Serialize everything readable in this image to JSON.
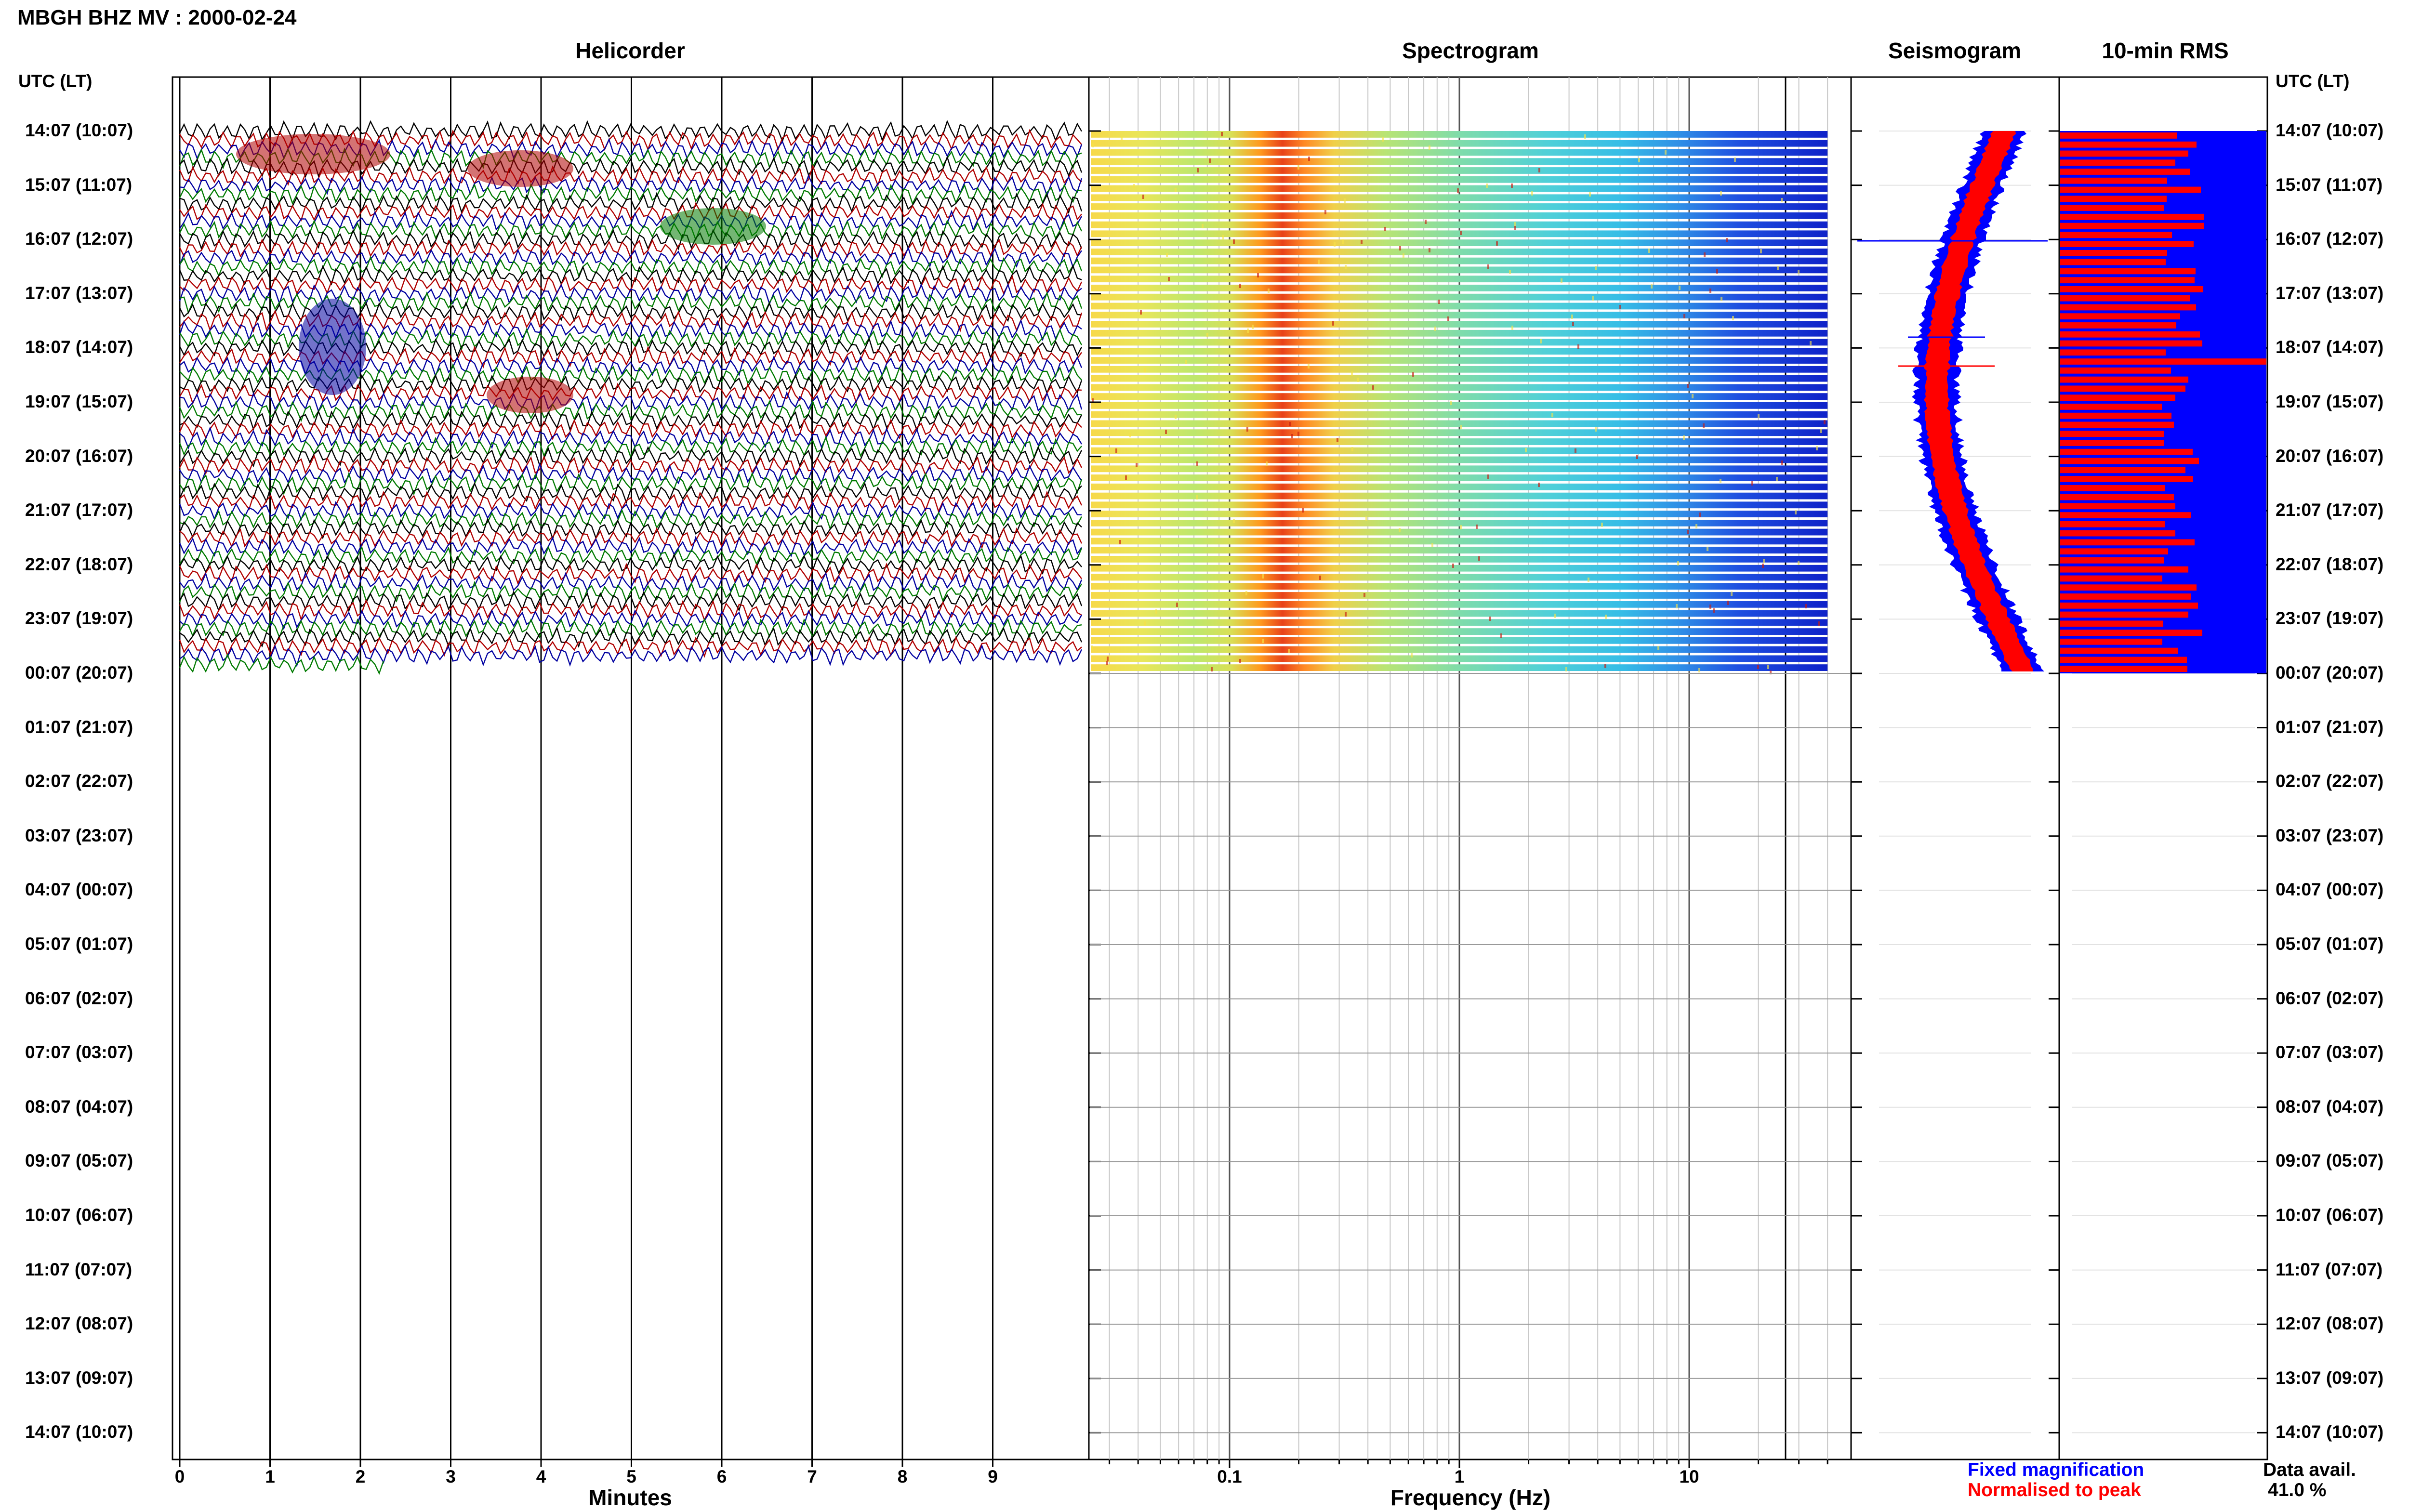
{
  "header": {
    "station_title": "MBGH BHZ MV : 2000-02-24",
    "utc_lt_label": "UTC (LT)"
  },
  "panels": {
    "helicorder_title": "Helicorder",
    "spectrogram_title": "Spectrogram",
    "seismogram_title": "Seismogram",
    "rms_title": "10-min RMS"
  },
  "time_labels": [
    "14:07 (10:07)",
    "15:07 (11:07)",
    "16:07 (12:07)",
    "17:07 (13:07)",
    "18:07 (14:07)",
    "19:07 (15:07)",
    "20:07 (16:07)",
    "21:07 (17:07)",
    "22:07 (18:07)",
    "23:07 (19:07)",
    "00:07 (20:07)",
    "01:07 (21:07)",
    "02:07 (22:07)",
    "03:07 (23:07)",
    "04:07 (00:07)",
    "05:07 (01:07)",
    "06:07 (02:07)",
    "07:07 (03:07)",
    "08:07 (04:07)",
    "09:07 (05:07)",
    "10:07 (06:07)",
    "11:07 (07:07)",
    "12:07 (08:07)",
    "13:07 (09:07)",
    "14:07 (10:07)"
  ],
  "legend": {
    "fixed_label": "Fixed magnification",
    "fixed_color": "#0000ff",
    "normalised_label": "Normalised to peak",
    "normalised_color": "#ff0000",
    "avail_label": "Data avail.",
    "avail_value": "41.0 %"
  },
  "chart_data": [
    {
      "type": "line",
      "title": "Helicorder",
      "xlabel": "Minutes",
      "x_ticks": [
        "0",
        "1",
        "2",
        "3",
        "4",
        "5",
        "6",
        "7",
        "8",
        "9"
      ],
      "xlim": [
        0,
        10
      ],
      "trace_colors": [
        "#000000",
        "#b00000",
        "#0000a0",
        "#007a00"
      ],
      "traces_per_hour": 6,
      "data_coverage_hours": 10,
      "total_hours": 24
    },
    {
      "type": "heatmap",
      "title": "Spectrogram",
      "xlabel": "Frequency (Hz)",
      "x_scale": "log",
      "xlim": [
        0.025,
        40
      ],
      "x_ticks": [
        "0.1",
        "1",
        "10"
      ],
      "peak_frequency_hz": 0.22,
      "data_coverage_hours": 10
    },
    {
      "type": "area",
      "title": "Seismogram",
      "series": [
        {
          "name": "Fixed magnification",
          "color": "#0000ff"
        },
        {
          "name": "Normalised to peak",
          "color": "#ff0000"
        }
      ]
    },
    {
      "type": "bar",
      "title": "10-min RMS",
      "series": [
        {
          "name": "Fixed magnification",
          "color": "#0000ff"
        },
        {
          "name": "Normalised to peak",
          "color": "#ff0000"
        }
      ]
    }
  ]
}
